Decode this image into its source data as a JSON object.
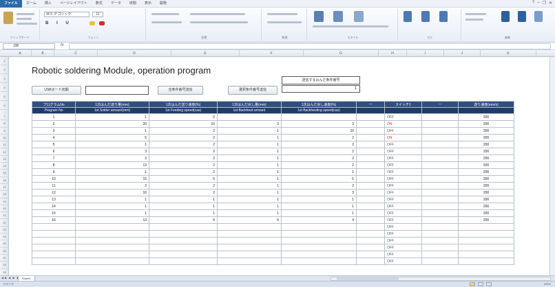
{
  "ribbon": {
    "tabs": [
      "ファイル",
      "ホーム",
      "挿入",
      "ページレイアウト",
      "数式",
      "データ",
      "校閲",
      "表示",
      "開発"
    ],
    "groups": [
      "クリップボード",
      "フォント",
      "配置",
      "数値",
      "スタイル",
      "セル",
      "編集"
    ],
    "font_name": "ＭＳ Ｐゴシック",
    "font_size": "11"
  },
  "formula_bar": {
    "name_box": "J38",
    "fx": "fx",
    "content": ""
  },
  "columns": [
    "A",
    "B",
    "C",
    "D",
    "E",
    "F",
    "G",
    "H",
    "I",
    "J",
    "K",
    "L"
  ],
  "sheet": {
    "title": "Robotic soldering Module, operation program",
    "usb_button": "USBボード初期",
    "usb_value": "",
    "condition_button": "全条件番号送信",
    "select_button": "選択条件番号送信",
    "select_box_label": "送信するはんだ条件番号",
    "select_box_value": "1"
  },
  "table": {
    "headers": [
      "プログラムNo",
      "1次はんだ送り量(mm)",
      "1次はんだ送り速度(%)",
      "1次はんだ戻し量(mm)",
      "1次はんだ戻し速度(%)",
      "—",
      "スイッチ1",
      "—",
      "送り速度(mm/s)"
    ],
    "subheaders": [
      "Program No",
      "1st Solder amount(mm)",
      "1st Feeding speed(cas)",
      "1st Backfeed amount",
      "1st Backfeeding speed(cas)",
      "",
      "",
      "",
      ""
    ],
    "rows": [
      {
        "no": "1",
        "amount": "1",
        "speed": "0",
        "back": "",
        "backspeed": "",
        "sw": "OFF",
        "rate": "200"
      },
      {
        "no": "2",
        "amount": "20",
        "speed": "10",
        "back": "3",
        "backspeed": "3",
        "sw": "ON",
        "rate": "200"
      },
      {
        "no": "3",
        "amount": "1",
        "speed": "2",
        "back": "1",
        "backspeed": "10",
        "sw": "OFF",
        "rate": "200"
      },
      {
        "no": "4",
        "amount": "5",
        "speed": "2",
        "back": "1",
        "backspeed": "2",
        "sw": "ON",
        "rate": "200"
      },
      {
        "no": "5",
        "amount": "1",
        "speed": "2",
        "back": "1",
        "backspeed": "2",
        "sw": "OFF",
        "rate": "200"
      },
      {
        "no": "6",
        "amount": "3",
        "speed": "2",
        "back": "1",
        "backspeed": "2",
        "sw": "OFF",
        "rate": "200"
      },
      {
        "no": "7",
        "amount": "3",
        "speed": "2",
        "back": "1",
        "backspeed": "2",
        "sw": "OFF",
        "rate": "200"
      },
      {
        "no": "8",
        "amount": "13",
        "speed": "2",
        "back": "1",
        "backspeed": "2",
        "sw": "OFF",
        "rate": "200"
      },
      {
        "no": "9",
        "amount": "1",
        "speed": "2",
        "back": "1",
        "backspeed": "1",
        "sw": "OFF",
        "rate": "200"
      },
      {
        "no": "10",
        "amount": "15",
        "speed": "5",
        "back": "1",
        "backspeed": "5",
        "sw": "OFF",
        "rate": "200"
      },
      {
        "no": "11",
        "amount": "2",
        "speed": "2",
        "back": "1",
        "backspeed": "2",
        "sw": "OFF",
        "rate": "200"
      },
      {
        "no": "12",
        "amount": "10",
        "speed": "2",
        "back": "1",
        "backspeed": "3",
        "sw": "OFF",
        "rate": "200"
      },
      {
        "no": "13",
        "amount": "1",
        "speed": "1",
        "back": "1",
        "backspeed": "1",
        "sw": "OFF",
        "rate": "200"
      },
      {
        "no": "14",
        "amount": "1",
        "speed": "1",
        "back": "1",
        "backspeed": "1",
        "sw": "OFF",
        "rate": "200"
      },
      {
        "no": "15",
        "amount": "1",
        "speed": "1",
        "back": "1",
        "backspeed": "1",
        "sw": "OFF",
        "rate": "200"
      },
      {
        "no": "16",
        "amount": "13",
        "speed": "6",
        "back": "5",
        "backspeed": "4",
        "sw": "OFF",
        "rate": "200"
      },
      {
        "no": "",
        "amount": "",
        "speed": "",
        "back": "",
        "backspeed": "",
        "sw": "OFF",
        "rate": ""
      },
      {
        "no": "",
        "amount": "",
        "speed": "",
        "back": "",
        "backspeed": "",
        "sw": "OFF",
        "rate": ""
      },
      {
        "no": "",
        "amount": "",
        "speed": "",
        "back": "",
        "backspeed": "",
        "sw": "OFF",
        "rate": ""
      },
      {
        "no": "",
        "amount": "",
        "speed": "",
        "back": "",
        "backspeed": "",
        "sw": "OFF",
        "rate": ""
      },
      {
        "no": "",
        "amount": "",
        "speed": "",
        "back": "",
        "backspeed": "",
        "sw": "OFF",
        "rate": ""
      },
      {
        "no": "",
        "amount": "",
        "speed": "",
        "back": "",
        "backspeed": "",
        "sw": "OFF",
        "rate": ""
      }
    ]
  },
  "sheet_tab": "Sheet1",
  "status": {
    "left": "コマンド",
    "zoom": "100%"
  },
  "colors": {
    "header_bg": "#2f4f7f",
    "on_text": "#d0302a",
    "file_tab": "#2c6aa8"
  }
}
